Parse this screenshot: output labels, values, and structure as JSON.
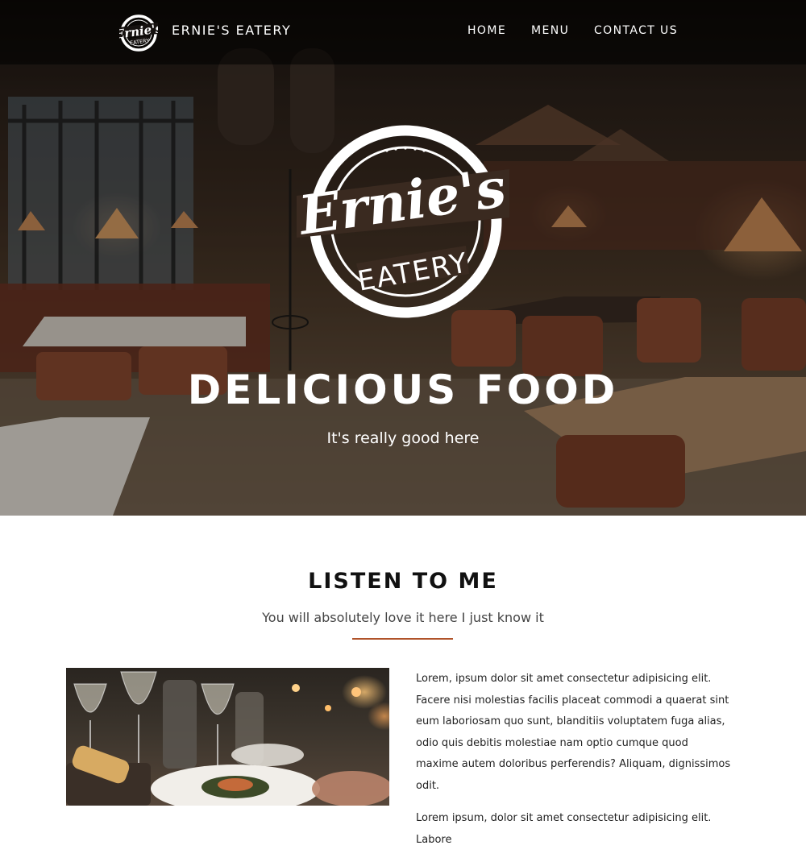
{
  "nav": {
    "brand": "ERNIE'S EATERY",
    "links": [
      "HOME",
      "MENU",
      "CONTACT US"
    ]
  },
  "logo": {
    "script_text": "Ernie's",
    "block_text": "EATERY"
  },
  "hero": {
    "title": "DELICIOUS FOOD",
    "subtitle": "It's really good here"
  },
  "section": {
    "title": "LISTEN TO ME",
    "subtitle": "You will absolutely love it here I just know it",
    "paragraphs": [
      "Lorem, ipsum dolor sit amet consectetur adipisicing elit. Facere nisi molestias facilis placeat commodi a quaerat sint eum laboriosam quo sunt, blanditiis voluptatem fuga alias, odio quis debitis molestiae nam optio cumque quod maxime autem doloribus perferendis? Aliquam, dignissimos odit.",
      "Lorem ipsum, dolor sit amet consectetur adipisicing elit. Labore"
    ]
  },
  "colors": {
    "accent": "#b0532a",
    "nav_background": "#000000",
    "text_dark": "#111111",
    "text_muted": "#444444"
  }
}
